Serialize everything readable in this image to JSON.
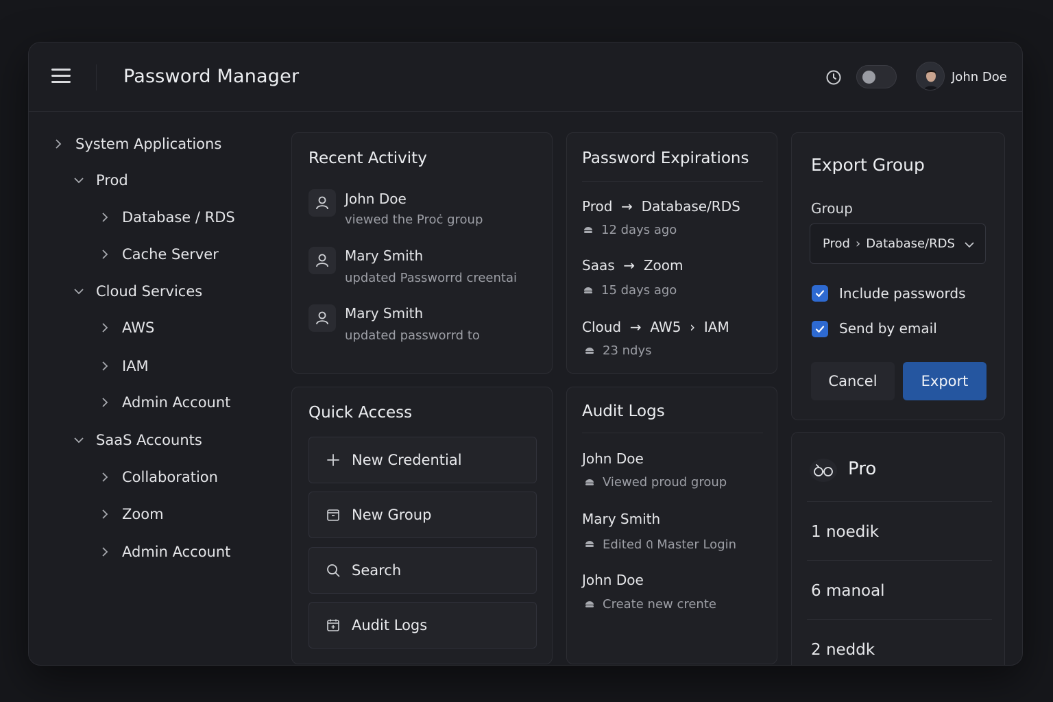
{
  "header": {
    "title": "Password Manager",
    "user_name": "John Doe"
  },
  "sidebar": {
    "items": [
      {
        "label": "System Applications",
        "expanded": false
      },
      {
        "label": "Prod",
        "expanded": true
      },
      {
        "label": "Database / RDS",
        "expanded": false
      },
      {
        "label": "Cache Server",
        "expanded": false
      },
      {
        "label": "Cloud Services",
        "expanded": true
      },
      {
        "label": "AWS",
        "expanded": false
      },
      {
        "label": "IAM",
        "expanded": false
      },
      {
        "label": "Admin Account",
        "expanded": false
      },
      {
        "label": "SaaS Accounts",
        "expanded": true
      },
      {
        "label": "Collaboration",
        "expanded": false
      },
      {
        "label": "Zoom",
        "expanded": false
      },
      {
        "label": "Admin Account",
        "expanded": false
      }
    ]
  },
  "recent_activity": {
    "title": "Recent Activity",
    "items": [
      {
        "name": "John Doe",
        "desc": "viewed the Proċ group"
      },
      {
        "name": "Mary Smith",
        "desc": "updated Passworrd creentai"
      },
      {
        "name": "Mary Smith",
        "desc": "updated passworrd to"
      }
    ]
  },
  "expirations": {
    "title": "Password Expirations",
    "items": [
      {
        "from": "Prod",
        "to": "Database/RDS",
        "extra": "",
        "when": "12 days ago"
      },
      {
        "from": "Saas",
        "to": "Zoom",
        "extra": "",
        "when": "15 days ago"
      },
      {
        "from": "Cloud",
        "to": "AW5",
        "extra": "IAM",
        "when": "23 ndys"
      }
    ]
  },
  "export_group": {
    "title": "Export Group",
    "group_label": "Group",
    "group_from": "Prod",
    "group_to": "Database/RDS",
    "include_passwords_label": "Include passwords",
    "include_passwords_checked": true,
    "send_email_label": "Send by email",
    "send_email_checked": true,
    "cancel_label": "Cancel",
    "export_label": "Export"
  },
  "quick_access": {
    "title": "Quick Access",
    "items": [
      {
        "label": "New Credential",
        "icon": "plus-icon"
      },
      {
        "label": "New Group",
        "icon": "folder-icon"
      },
      {
        "label": "Search",
        "icon": "search-icon"
      },
      {
        "label": "Audit Logs",
        "icon": "calendar-icon"
      }
    ]
  },
  "audit_logs": {
    "title": "Audit Logs",
    "items": [
      {
        "name": "John Doe",
        "desc": "Viewed proud group"
      },
      {
        "name": "Mary Smith",
        "desc": "Edited ꢡ Master Login"
      },
      {
        "name": "John Doe",
        "desc": "Create new crente"
      }
    ]
  },
  "pro": {
    "title": "Pro",
    "stats": [
      "1 noedik",
      "6 manoal",
      "2 neddk"
    ]
  },
  "colors": {
    "accent": "#2556a0",
    "checkbox": "#2e6ad1",
    "background": "#1c1d22"
  }
}
